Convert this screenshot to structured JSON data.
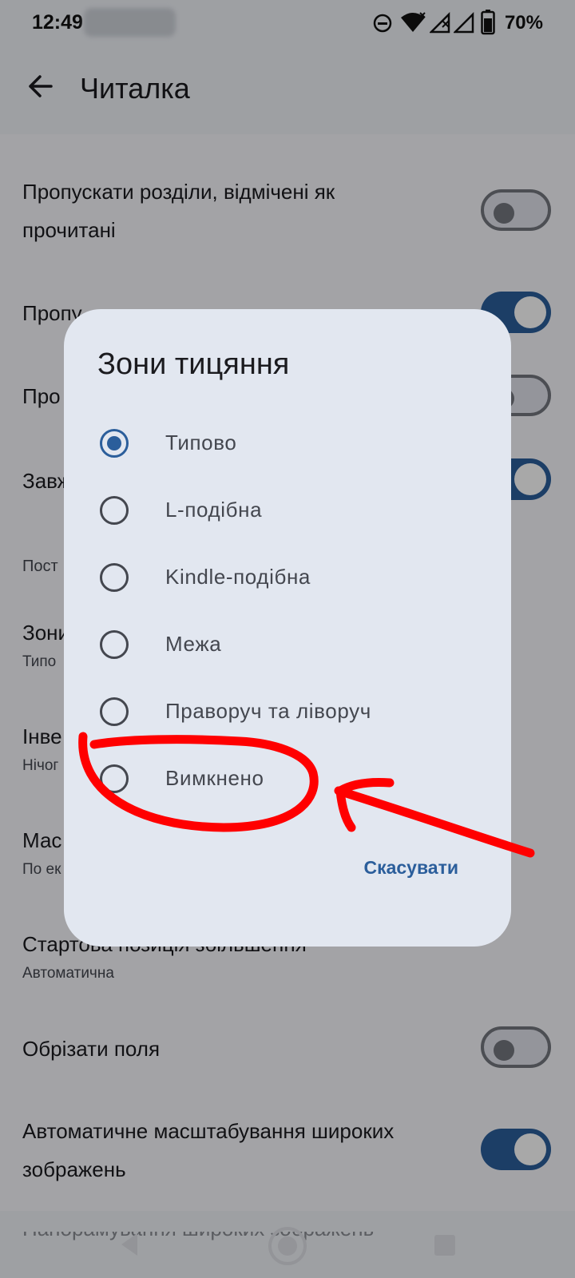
{
  "status_bar": {
    "time": "12:49",
    "battery": "70%"
  },
  "app_bar": {
    "title": "Читалка"
  },
  "settings": {
    "skip_read": "Пропускати розділи, відмічені як",
    "skip_read_line2": "прочитані",
    "row2_partial": "Пропу",
    "row3_partial": "Про",
    "row4_partial": "Завж",
    "section_partial": "Пост",
    "tap_zones_partial": "Зони",
    "tap_zones_sub_partial": "Типо",
    "invert_partial": "Інве",
    "invert_sub_partial": "Нічог",
    "scale_partial": "Мас",
    "scale_sub_partial": "По ек",
    "zoom_start": "Стартова позиція збільшення",
    "zoom_start_value": "Автоматична",
    "crop_borders": "Обрізати поля",
    "auto_scale_wide": "Автоматичне масштабування широких",
    "auto_scale_wide_line2": "зображень",
    "pan_wide_partial": "Панорамування широких зображень"
  },
  "dialog": {
    "title": "Зони тицяння",
    "options": [
      "Типово",
      "L-подібна",
      "Kindle-подібна",
      "Межа",
      "Праворуч та ліворуч",
      "Вимкнено"
    ],
    "selected": "Типово",
    "cancel": "Скасувати"
  },
  "colors": {
    "accent": "#2b5e9b",
    "annotation": "#ff0000"
  }
}
